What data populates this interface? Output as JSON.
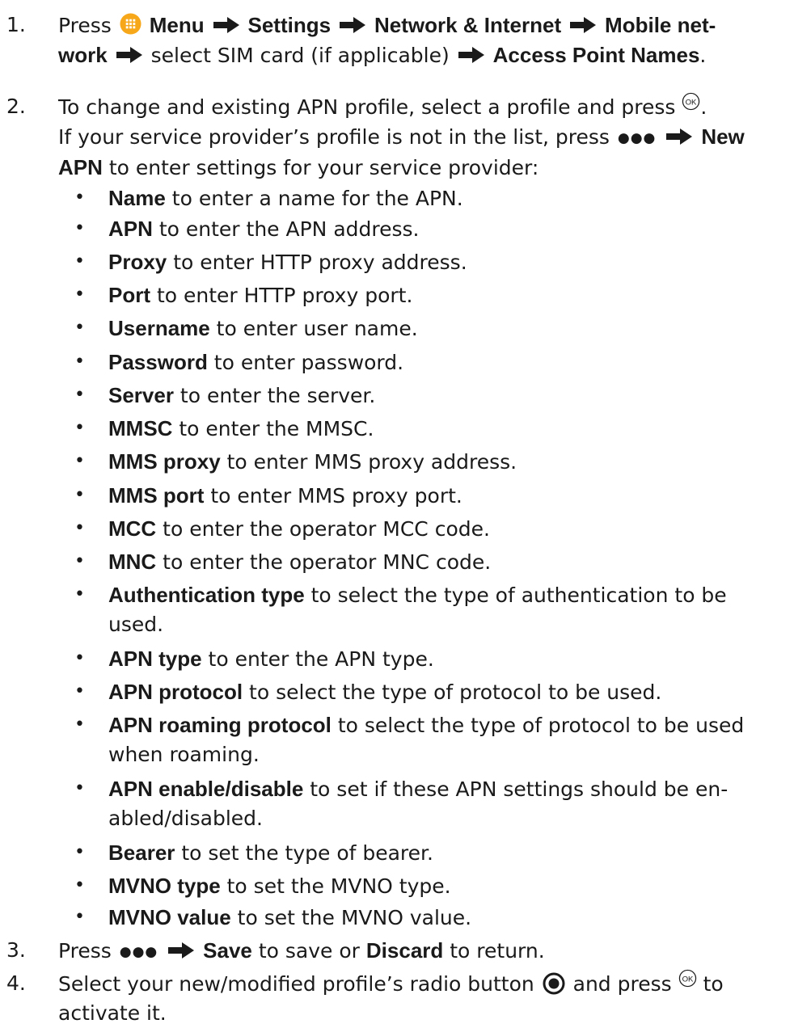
{
  "step1": {
    "num": "1.",
    "press": "Press",
    "menu": "Menu",
    "settings": "Settings",
    "network": "Network & Internet",
    "mobile_a": "Mobile net-",
    "mobile_b": "work",
    "select_sim": "select SIM card (if applicable)",
    "apn_names": "Access Point Names",
    "end": "."
  },
  "step2": {
    "num": "2.",
    "line1": "To change and existing APN profile, select a profile and press",
    "line1_end": ".",
    "line2": "If your service provider’s profile is not in the list, press",
    "new": "New",
    "apn": "APN",
    "line3": "to enter settings for your service provider:"
  },
  "bullets": [
    {
      "bold": "Name",
      "text": " to enter a name for the APN."
    },
    {
      "bold": "APN",
      "text": " to enter the APN address."
    },
    {
      "bold": "Proxy",
      "text": " to enter HTTP proxy address."
    },
    {
      "bold": "Port",
      "text": " to enter HTTP proxy port."
    },
    {
      "bold": "Username",
      "text": " to enter user name."
    },
    {
      "bold": "Password",
      "text": " to enter password."
    },
    {
      "bold": "Server",
      "text": " to enter the server."
    },
    {
      "bold": "MMSC",
      "text": " to enter the MMSC."
    },
    {
      "bold": "MMS proxy",
      "text": " to enter MMS proxy address."
    },
    {
      "bold": "MMS port",
      "text": " to enter MMS proxy port."
    },
    {
      "bold": "MCC",
      "text": " to enter the operator MCC code."
    },
    {
      "bold": "MNC",
      "text": " to enter the operator MNC code."
    },
    {
      "bold": "Authentication type",
      "text": " to select the type of authentication to be",
      "text2": "used."
    },
    {
      "bold": "APN type",
      "text": " to enter the APN type."
    },
    {
      "bold": "APN protocol",
      "text": " to select the type of protocol to be used."
    },
    {
      "bold": "APN roaming protocol",
      "text": " to select the type of protocol to be used",
      "text2": "when roaming."
    },
    {
      "bold": "APN enable/disable",
      "text": " to set if these APN settings should be en-",
      "text2": "abled/disabled."
    },
    {
      "bold": "Bearer",
      "text": " to set the type of bearer."
    },
    {
      "bold": "MVNO type",
      "text": " to set the MVNO type."
    },
    {
      "bold": "MVNO value",
      "text": " to set the MVNO value."
    }
  ],
  "step3": {
    "num": "3.",
    "press": "Press",
    "save": "Save",
    "mid": "to save or",
    "discard": "Discard",
    "end": "to return."
  },
  "step4": {
    "num": "4.",
    "text_a": "Select your new/modified profile’s radio button",
    "text_b": "and press",
    "text_c": "to",
    "line2": "activate it."
  },
  "icons": {
    "menu_icon_color": "#f6a81a",
    "text_color": "#1a1a1a"
  }
}
